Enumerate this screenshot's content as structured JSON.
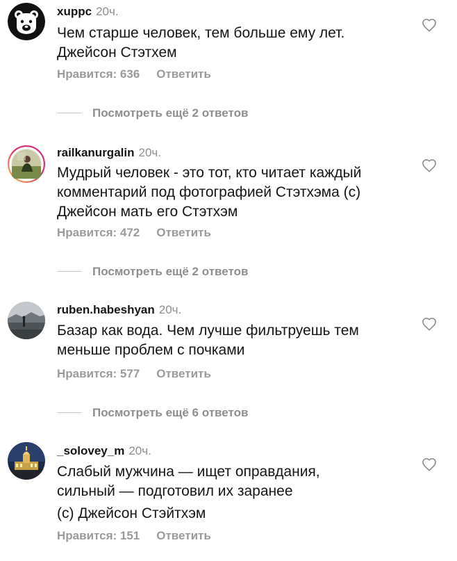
{
  "comments": [
    {
      "username": "xuppc",
      "time": "20ч.",
      "lines": [
        "Чем старше человек, тем больше ему лет.",
        "Джейсон Стэтхем"
      ],
      "likes": "Нравится: 636",
      "reply": "Ответить",
      "more_replies": "Посмотреть ещё 2 ответов",
      "avatar_icon": "bear-logo-icon"
    },
    {
      "username": "railkanurgalin",
      "time": "20ч.",
      "lines": [
        "Мудрый человек - это тот, кто читает каждый",
        "комментарий под фотографией Стэтхэма (с)",
        "Джейсон мать его Стэтхэм"
      ],
      "likes": "Нравится: 472",
      "reply": "Ответить",
      "more_replies": "Посмотреть ещё 2 ответов",
      "avatar_icon": "person-photo-avatar"
    },
    {
      "username": "ruben.habeshyan",
      "time": "20ч.",
      "lines": [
        "Базар как вода. Чем лучше фильтруешь тем",
        "меньше проблем с почками"
      ],
      "likes": "Нравится: 577",
      "reply": "Ответить",
      "more_replies": "Посмотреть ещё 6 ответов",
      "avatar_icon": "landscape-photo-avatar"
    },
    {
      "username": "_solovey_m",
      "time": "20ч.",
      "lines": [
        "Слабый мужчина — ищет оправдания,",
        "сильный — подготовил их заранее",
        "(с) Джейсон Стэйтхэм"
      ],
      "likes": "Нравится: 151",
      "reply": "Ответить",
      "avatar_icon": "building-photo-avatar"
    }
  ],
  "colors": {
    "text": "#151515",
    "muted": "#8e8e8e",
    "actions": "#9a9a9a",
    "divider": "#c7c7c7"
  }
}
